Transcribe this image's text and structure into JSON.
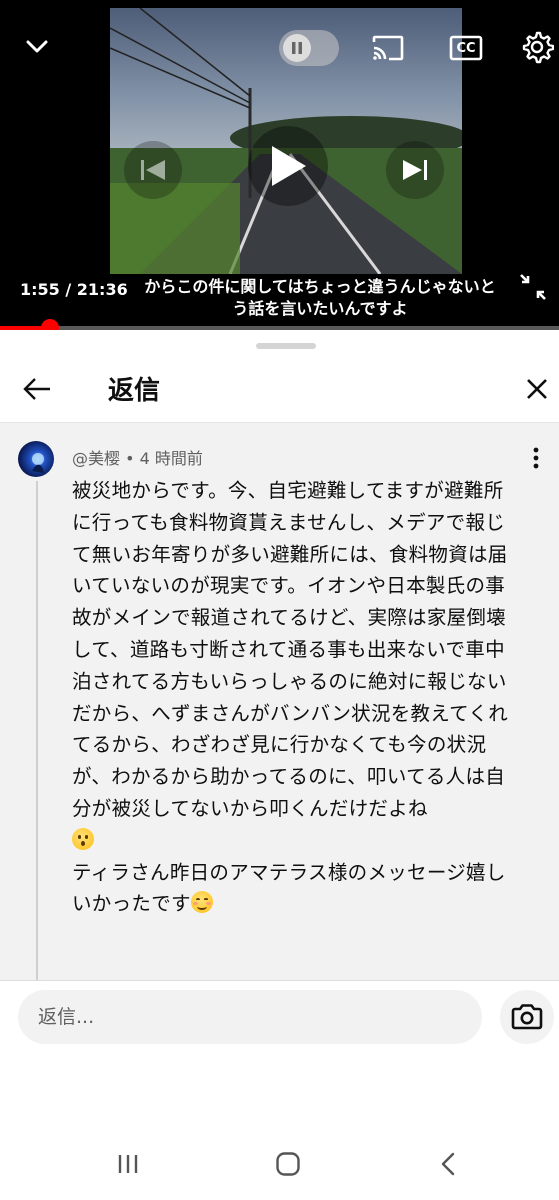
{
  "player": {
    "caption": "からこの件に関してはちょっと違うんじゃないと\nう話を言いたいんですよ",
    "time_readout": "1:55 / 21:36",
    "progress_fraction": 0.089,
    "accent_color": "#ff0000",
    "icons": {
      "minimize": "chevron-down-icon",
      "pause": "pause-icon",
      "cast": "cast-icon",
      "captions": "closed-captions-icon",
      "settings": "gear-icon",
      "previous": "skip-previous-icon",
      "play": "play-icon",
      "next": "skip-next-icon",
      "fullscreen": "exit-fullscreen-icon"
    },
    "cc_label": "CC"
  },
  "sheet": {
    "title": "返信",
    "back_icon": "arrow-left-icon",
    "close_icon": "close-icon"
  },
  "comment": {
    "author": "@美樱",
    "separator": " • ",
    "age": "4 時間前",
    "body": "被災地からです。今、自宅避難してますが避難所に行っても食料物資貰えませんし、メデアで報じて無いお年寄りが多い避難所には、食料物資は届いていないのが現実です。イオンや日本製氏の事故がメインで報道されてるけど、実際は家屋倒壊して、道路も寸断されて通る事も出来ないで車中泊されてる方もいらっしゃるのに絶対に報じないだから、へずまさんがバンバン状況を教えてくれてるから、わざわざ見に行かなくても今の状況が、わかるから助かってるのに、叩いてる人は自分が被災してないから叩くんだけだよね",
    "emoji_1": "hushed-face-emoji",
    "body_2": "ティラさん昨日のアマテラス様のメッセージ嬉しいかったです",
    "emoji_2": "smiling-face-emoji",
    "more_icon": "more-vertical-icon"
  },
  "composer": {
    "placeholder": "返信...",
    "camera_icon": "camera-icon"
  },
  "navbar": {
    "recent_icon": "recent-apps-icon",
    "home_icon": "home-icon",
    "back_icon": "back-chevron-icon"
  }
}
